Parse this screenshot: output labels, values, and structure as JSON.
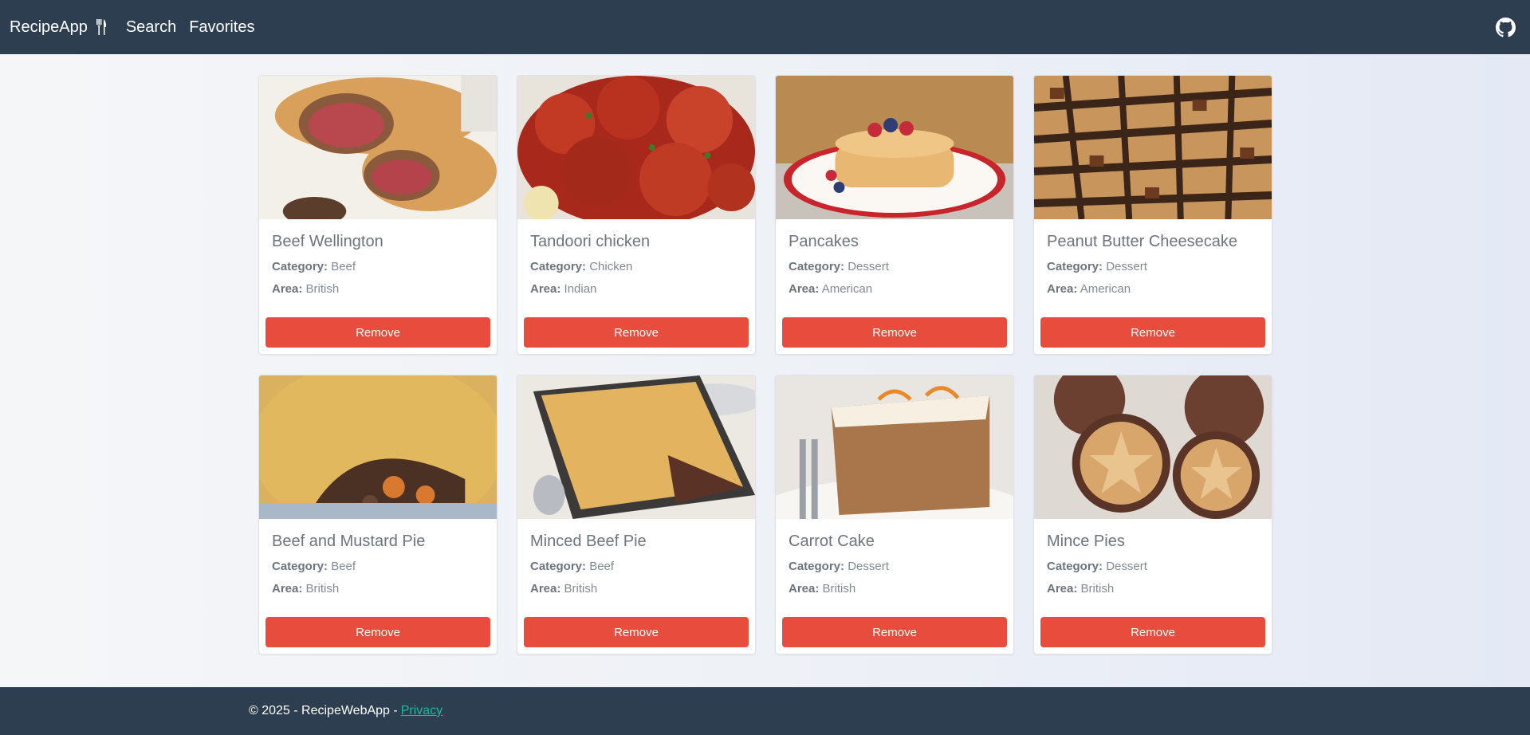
{
  "navbar": {
    "brand": "RecipeApp",
    "links": [
      "Search",
      "Favorites"
    ],
    "github_icon": "github-icon"
  },
  "labels": {
    "category": "Category:",
    "area": "Area:",
    "remove": "Remove"
  },
  "recipes": [
    {
      "title": "Beef Wellington",
      "category": "Beef",
      "area": "British"
    },
    {
      "title": "Tandoori chicken",
      "category": "Chicken",
      "area": "Indian"
    },
    {
      "title": "Pancakes",
      "category": "Dessert",
      "area": "American"
    },
    {
      "title": "Peanut Butter Cheesecake",
      "category": "Dessert",
      "area": "American"
    },
    {
      "title": "Beef and Mustard Pie",
      "category": "Beef",
      "area": "British"
    },
    {
      "title": "Minced Beef Pie",
      "category": "Beef",
      "area": "British"
    },
    {
      "title": "Carrot Cake",
      "category": "Dessert",
      "area": "British"
    },
    {
      "title": "Mince Pies",
      "category": "Dessert",
      "area": "British"
    }
  ],
  "footer": {
    "text": "© 2025 - RecipeWebApp -",
    "privacy": "Privacy"
  },
  "colors": {
    "nav": "#2c3e50",
    "remove_button": "#e74c3c",
    "link": "#1abc9c"
  }
}
